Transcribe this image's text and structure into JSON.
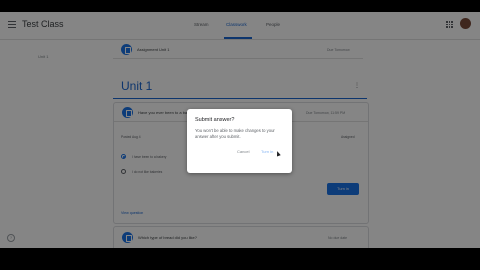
{
  "header": {
    "class_title": "Test Class",
    "tabs": [
      "Stream",
      "Classwork",
      "People"
    ]
  },
  "sidebar": {
    "topic": "Unit 1"
  },
  "stream": {
    "top_item": {
      "title": "Assignment Unit 1",
      "meta": "Due Tomorrow"
    },
    "unit_title": "Unit 1",
    "question_card": {
      "title": "Have you ever been to a bakery?",
      "meta": "Due Tomorrow, 11:59 PM",
      "posted": "Posted Aug 4",
      "status": "Assigned",
      "option_1": "I have been to a bakery",
      "option_2": "I do not like bakeries",
      "submit_label": "Turn in",
      "view_link": "View question"
    },
    "bottom_item": {
      "title": "Which type of bread did you like?",
      "meta": "No due date"
    }
  },
  "dialog": {
    "title": "Submit answer?",
    "body": "You won't be able to make changes to your answer after you submit.",
    "cancel_label": "Cancel",
    "turnin_label": "Turn in"
  }
}
